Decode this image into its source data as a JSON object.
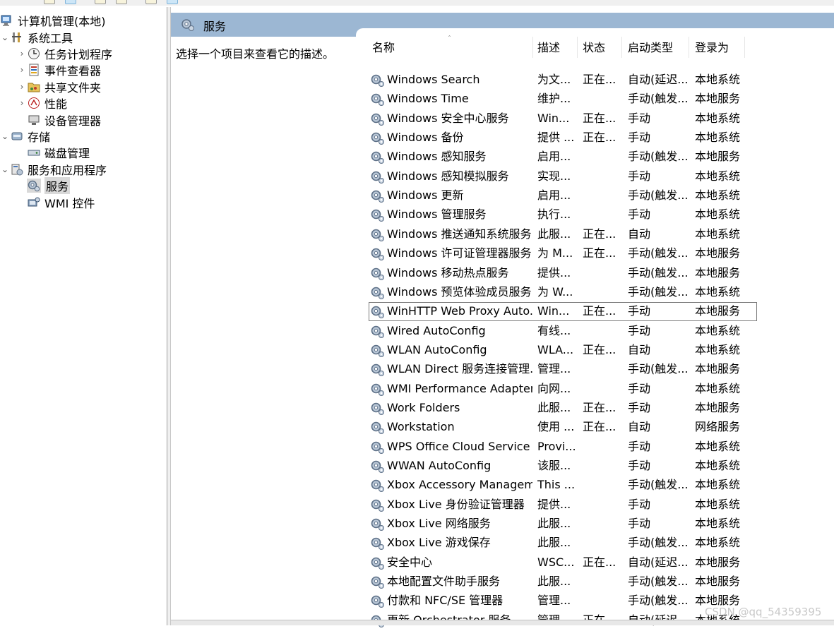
{
  "colors": {
    "header_bg": "#9cb7d3",
    "selected_bg": "#d9d9d9"
  },
  "tree": {
    "root": {
      "label": "计算机管理(本地)",
      "icon": "computer-management-icon"
    },
    "items": [
      {
        "label": "系统工具",
        "icon": "system-tools-icon",
        "expander": "⌄"
      },
      {
        "label": "任务计划程序",
        "icon": "clock-icon",
        "expander": "›"
      },
      {
        "label": "事件查看器",
        "icon": "event-viewer-icon",
        "expander": "›"
      },
      {
        "label": "共享文件夹",
        "icon": "shared-folder-icon",
        "expander": "›"
      },
      {
        "label": "性能",
        "icon": "performance-icon",
        "expander": "›"
      },
      {
        "label": "设备管理器",
        "icon": "device-manager-icon",
        "expander": ""
      },
      {
        "label": "存储",
        "icon": "storage-icon",
        "expander": "⌄"
      },
      {
        "label": "磁盘管理",
        "icon": "disk-icon",
        "expander": ""
      },
      {
        "label": "服务和应用程序",
        "icon": "services-apps-icon",
        "expander": "⌄"
      },
      {
        "label": "服务",
        "icon": "gear-icon",
        "expander": ""
      },
      {
        "label": "WMI 控件",
        "icon": "wmi-icon",
        "expander": ""
      }
    ]
  },
  "main": {
    "title": "服务",
    "description_prompt": "选择一个项目来查看它的描述。",
    "columns": {
      "name": "名称",
      "description": "描述",
      "status": "状态",
      "startup": "启动类型",
      "logon": "登录为"
    },
    "sort_indicator": "ˆ",
    "rows": [
      {
        "name": "Windows Search",
        "description": "为文...",
        "status": "正在...",
        "startup": "自动(延迟...",
        "logon": "本地系统"
      },
      {
        "name": "Windows Time",
        "description": "维护...",
        "status": "",
        "startup": "手动(触发...",
        "logon": "本地服务"
      },
      {
        "name": "Windows 安全中心服务",
        "description": "Win...",
        "status": "正在...",
        "startup": "手动",
        "logon": "本地系统"
      },
      {
        "name": "Windows 备份",
        "description": "提供 ...",
        "status": "正在...",
        "startup": "手动",
        "logon": "本地系统"
      },
      {
        "name": "Windows 感知服务",
        "description": "启用...",
        "status": "",
        "startup": "手动(触发...",
        "logon": "本地服务"
      },
      {
        "name": "Windows 感知模拟服务",
        "description": "实现...",
        "status": "",
        "startup": "手动",
        "logon": "本地系统"
      },
      {
        "name": "Windows 更新",
        "description": "启用...",
        "status": "",
        "startup": "手动(触发...",
        "logon": "本地系统"
      },
      {
        "name": "Windows 管理服务",
        "description": "执行...",
        "status": "",
        "startup": "手动",
        "logon": "本地系统"
      },
      {
        "name": "Windows 推送通知系统服务",
        "description": "此服...",
        "status": "正在...",
        "startup": "自动",
        "logon": "本地系统"
      },
      {
        "name": "Windows 许可证管理器服务",
        "description": "为 M...",
        "status": "正在...",
        "startup": "手动(触发...",
        "logon": "本地服务"
      },
      {
        "name": "Windows 移动热点服务",
        "description": "提供...",
        "status": "",
        "startup": "手动(触发...",
        "logon": "本地服务"
      },
      {
        "name": "Windows 预览体验成员服务",
        "description": "为 W...",
        "status": "",
        "startup": "手动(触发...",
        "logon": "本地系统"
      },
      {
        "name": "WinHTTP Web Proxy Auto...",
        "description": "Win...",
        "status": "正在...",
        "startup": "手动",
        "logon": "本地服务"
      },
      {
        "name": "Wired AutoConfig",
        "description": "有线...",
        "status": "",
        "startup": "手动",
        "logon": "本地系统"
      },
      {
        "name": "WLAN AutoConfig",
        "description": "WLA...",
        "status": "正在...",
        "startup": "自动",
        "logon": "本地系统"
      },
      {
        "name": "WLAN Direct 服务连接管理...",
        "description": "管理...",
        "status": "",
        "startup": "手动(触发...",
        "logon": "本地服务"
      },
      {
        "name": "WMI Performance Adapter",
        "description": "向网...",
        "status": "",
        "startup": "手动",
        "logon": "本地系统"
      },
      {
        "name": "Work Folders",
        "description": "此服...",
        "status": "正在...",
        "startup": "手动",
        "logon": "本地服务"
      },
      {
        "name": "Workstation",
        "description": "使用 ...",
        "status": "正在...",
        "startup": "自动",
        "logon": "网络服务"
      },
      {
        "name": "WPS Office Cloud Service",
        "description": "Provi...",
        "status": "",
        "startup": "手动",
        "logon": "本地系统"
      },
      {
        "name": "WWAN AutoConfig",
        "description": "该服...",
        "status": "",
        "startup": "手动",
        "logon": "本地系统"
      },
      {
        "name": "Xbox Accessory Managem...",
        "description": "This ...",
        "status": "",
        "startup": "手动(触发...",
        "logon": "本地系统"
      },
      {
        "name": "Xbox Live 身份验证管理器",
        "description": "提供...",
        "status": "",
        "startup": "手动",
        "logon": "本地系统"
      },
      {
        "name": "Xbox Live 网络服务",
        "description": "此服...",
        "status": "",
        "startup": "手动",
        "logon": "本地系统"
      },
      {
        "name": "Xbox Live 游戏保存",
        "description": "此服...",
        "status": "",
        "startup": "手动(触发...",
        "logon": "本地系统"
      },
      {
        "name": "安全中心",
        "description": "WSC...",
        "status": "正在...",
        "startup": "自动(延迟...",
        "logon": "本地服务"
      },
      {
        "name": "本地配置文件助手服务",
        "description": "此服...",
        "status": "",
        "startup": "手动(触发...",
        "logon": "本地服务"
      },
      {
        "name": "付款和 NFC/SE 管理器",
        "description": "管理...",
        "status": "",
        "startup": "手动(触发...",
        "logon": "本地服务"
      },
      {
        "name": "更新 Orchestrator 服务",
        "description": "管理 ...",
        "status": "正在...",
        "startup": "自动(延迟...",
        "logon": "本地系统"
      }
    ]
  },
  "watermark": "CSDN @qq_54359395"
}
